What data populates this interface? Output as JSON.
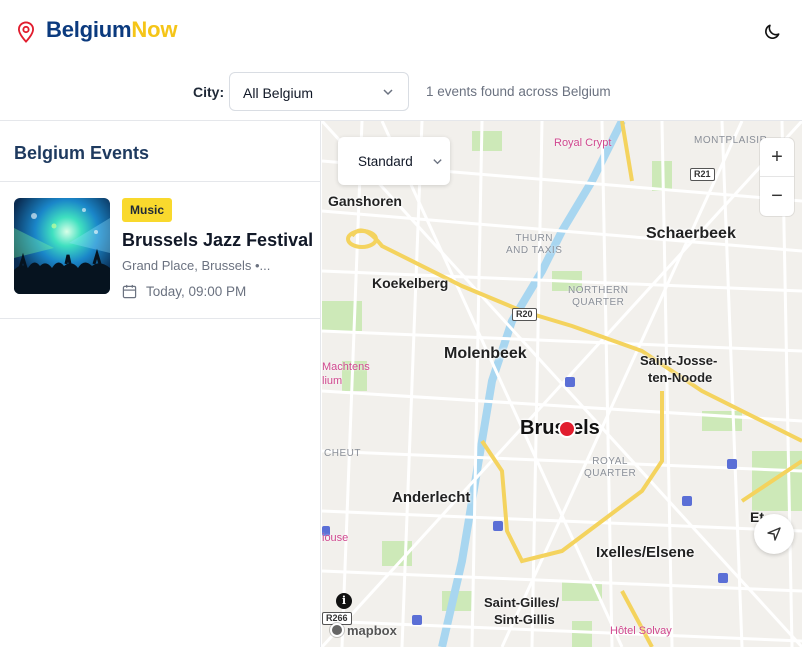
{
  "header": {
    "brand_part1": "Belgium",
    "brand_part2": "Now",
    "brand_colors": {
      "part1": "#0b3a7e",
      "part2": "#f5c518",
      "pin": "#e11d2e"
    },
    "icons": {
      "logo": "map-pin-icon",
      "theme": "moon-icon"
    }
  },
  "filter": {
    "city_label": "City:",
    "city_value": "All Belgium",
    "events_count_text": "1 events found across Belgium"
  },
  "sidebar": {
    "title": "Belgium Events",
    "events": [
      {
        "category": "Music",
        "title": "Brussels Jazz Festival",
        "location": "Grand Place, Brussels •...",
        "time": "Today, 09:00 PM"
      }
    ]
  },
  "map": {
    "style_value": "Standard",
    "zoom_in": "+",
    "zoom_out": "−",
    "info": "i",
    "attribution": "mapbox",
    "marker_color": "#e11d2e",
    "labels": {
      "ganshoren": "Ganshoren",
      "schaerbeek": "Schaerbeek",
      "koekelberg": "Koekelberg",
      "molenbeek": "Molenbeek",
      "saint_josse_1": "Saint-Josse-",
      "saint_josse_2": "ten-Noode",
      "brussels_1": "Brus",
      "brussels_2": "els",
      "anderlecht": "Anderlecht",
      "ixelles": "Ixelles/Elsene",
      "saint_gilles_1": "Saint-Gilles/",
      "saint_gilles_2": "Sint-Gillis",
      "etterbeek": "Et",
      "thurn_1": "THURN",
      "thurn_2": "AND TAXIS",
      "northern_1": "NORTHERN",
      "northern_2": "QUARTER",
      "royal_1": "ROYAL",
      "royal_2": "QUARTER",
      "montplaisir": "MONTPLAISIR",
      "cheut": "CHEUT",
      "royal_crypt": "Royal Crypt",
      "machtens_1": "Machtens",
      "machtens_2": "lium",
      "house": "iouse",
      "hotel_solvay": "Hôtel Solvay",
      "r20": "R20",
      "r21": "R21",
      "r266": "R266"
    }
  }
}
